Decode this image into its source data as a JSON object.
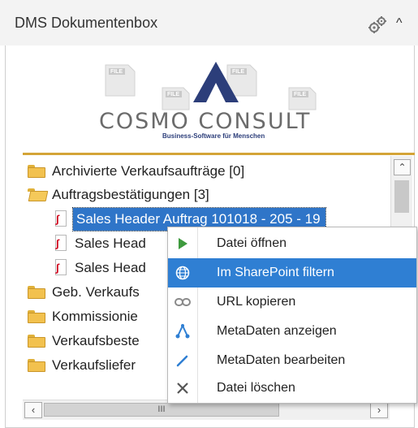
{
  "panel": {
    "title": "DMS Dokumentenbox"
  },
  "logo": {
    "brand": "COSMO CONSULT",
    "tagline": "Business-Software für Menschen",
    "file_label": "FILE"
  },
  "tree": {
    "items": [
      {
        "label": "Archivierte Verkaufsaufträge [0]",
        "type": "folder"
      },
      {
        "label": "Auftragsbestätigungen [3]",
        "type": "folder-open"
      },
      {
        "label": "Sales Header Auftrag 101018 - 205 - 19",
        "type": "pdf",
        "selected": true
      },
      {
        "label": "Sales Head",
        "type": "pdf"
      },
      {
        "label": "Sales Head",
        "type": "pdf"
      },
      {
        "label": "Geb. Verkaufs",
        "type": "folder"
      },
      {
        "label": "Kommissionie",
        "type": "folder"
      },
      {
        "label": "Verkaufsbeste",
        "type": "folder"
      },
      {
        "label": "Verkaufsliefer",
        "type": "folder"
      }
    ]
  },
  "hscroll": {
    "thumb_grip": "III"
  },
  "context_menu": {
    "items": [
      {
        "label": "Datei öffnen",
        "icon": "play-icon"
      },
      {
        "label": "Im SharePoint filtern",
        "icon": "globe-icon",
        "highlighted": true
      },
      {
        "label": "URL kopieren",
        "icon": "link-icon"
      },
      {
        "label": "MetaDaten anzeigen",
        "icon": "metadata-icon"
      },
      {
        "label": "MetaDaten bearbeiten",
        "icon": "pencil-icon"
      },
      {
        "label": "Datei löschen",
        "icon": "delete-icon"
      }
    ]
  },
  "colors": {
    "accent_line": "#d4a437",
    "selection": "#2f75c8",
    "menu_highlight": "#2f7fd3",
    "logo_blue": "#2c3e7a"
  }
}
